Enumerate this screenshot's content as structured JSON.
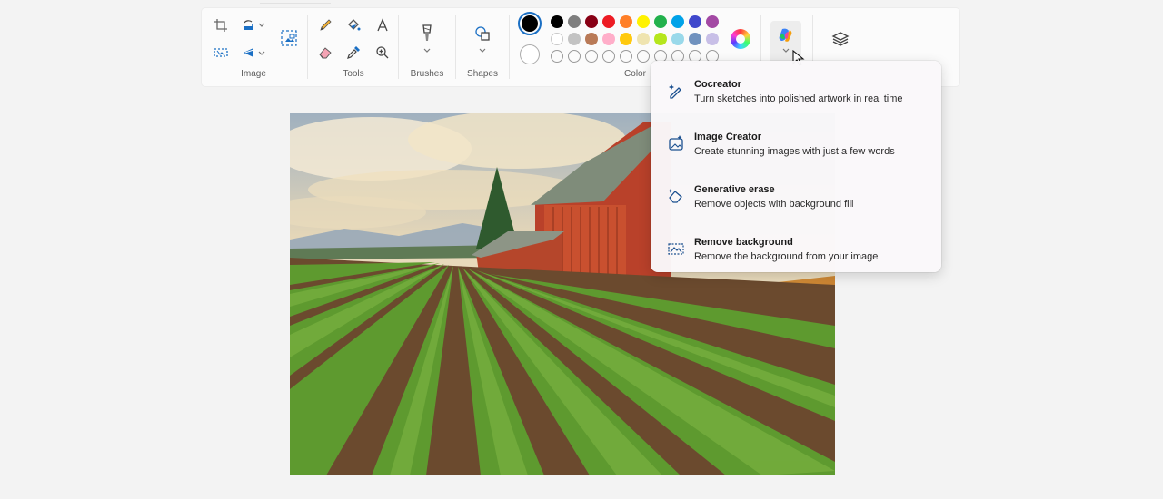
{
  "ribbon": {
    "groups": {
      "image": "Image",
      "tools": "Tools",
      "brushes": "Brushes",
      "shapes": "Shapes",
      "color": "Color"
    }
  },
  "palette": {
    "row1": [
      "#000000",
      "#7f7f7f",
      "#880015",
      "#ed1c24",
      "#ff7f27",
      "#fff200",
      "#22b14c",
      "#00a2e8",
      "#3f48cc",
      "#a349a4"
    ],
    "row2": [
      "#ffffff",
      "#c3c3c3",
      "#b97a57",
      "#ffaec9",
      "#ffc90e",
      "#efe4b0",
      "#b5e61d",
      "#99d9ea",
      "#7092be",
      "#c8bfe7"
    ],
    "selected_primary": "#000000",
    "selected_secondary": "#ffffff"
  },
  "menu": {
    "items": [
      {
        "title": "Cocreator",
        "desc": "Turn sketches into polished artwork in real time",
        "icon": "sparkle-pen-icon"
      },
      {
        "title": "Image Creator",
        "desc": "Create stunning images with just a few words",
        "icon": "image-sparkle-icon"
      },
      {
        "title": "Generative erase",
        "desc": "Remove objects with background fill",
        "icon": "eraser-sparkle-icon"
      },
      {
        "title": "Remove background",
        "desc": "Remove the background from your image",
        "icon": "remove-background-icon"
      }
    ]
  },
  "canvas": {
    "image_name": "farm-painting-image"
  }
}
